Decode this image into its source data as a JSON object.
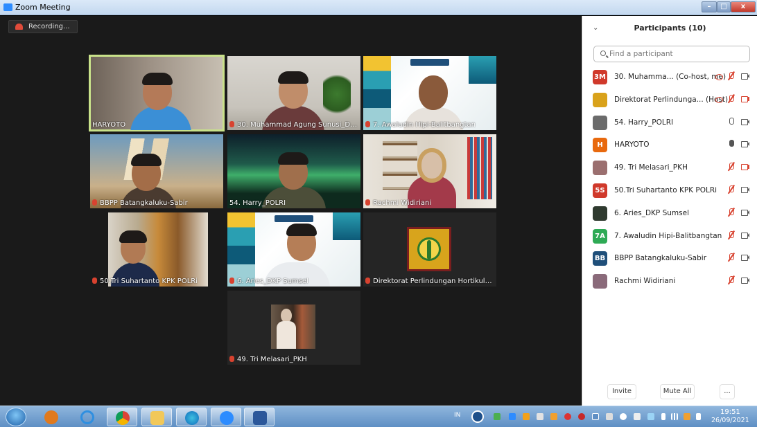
{
  "window": {
    "title": "Zoom Meeting",
    "min": "–",
    "max": "□",
    "close": "x"
  },
  "recording": {
    "label": "Recording..."
  },
  "tiles": [
    {
      "name": "HARYOTO",
      "muted": false
    },
    {
      "name": "30. Muhammad Agung Sunusi_Ditje...",
      "muted": true
    },
    {
      "name": "7. Awaludin Hipi-Balitbangtan",
      "muted": true
    },
    {
      "name": "BBPP Batangkaluku-Sabir",
      "muted": true
    },
    {
      "name": "54. Harry_POLRI",
      "muted": false
    },
    {
      "name": "Rachmi Widiriani",
      "muted": true
    },
    {
      "name": "50.Tri Suhartanto KPK POLRi",
      "muted": true
    },
    {
      "name": "6. Aries_DKP Sumsel",
      "muted": true
    },
    {
      "name": "Direktorat Perlindungan Hortikultura",
      "muted": true
    },
    {
      "name": "49. Tri Melasari_PKH",
      "muted": true
    }
  ],
  "panel": {
    "title": "Participants (10)",
    "search_placeholder": "Find a participant",
    "invite": "Invite",
    "mute_all": "Mute All",
    "more": "...",
    "participants": [
      {
        "name": "30. Muhamma...  (Co-host, me)",
        "avatar": "3M",
        "color": "#d0392b",
        "mic": "off",
        "cam": "on",
        "rec": true
      },
      {
        "name": "Direktorat Perlindunga...  (Host)",
        "avatar": "",
        "color": "#d9a21b",
        "mic": "off",
        "cam": "off",
        "rec": true
      },
      {
        "name": "54. Harry_POLRI",
        "avatar": "",
        "color": "#6b6b6b",
        "mic": "on",
        "cam": "on",
        "rec": false
      },
      {
        "name": "HARYOTO",
        "avatar": "H",
        "color": "#e8690e",
        "mic": "speaking",
        "cam": "on",
        "rec": false
      },
      {
        "name": "49. Tri Melasari_PKH",
        "avatar": "",
        "color": "#9b6f6f",
        "mic": "off",
        "cam": "off",
        "rec": false
      },
      {
        "name": "50.Tri Suhartanto KPK POLRi",
        "avatar": "5S",
        "color": "#d0392b",
        "mic": "off",
        "cam": "on",
        "rec": false
      },
      {
        "name": "6. Aries_DKP Sumsel",
        "avatar": "",
        "color": "#2f3a2f",
        "mic": "off",
        "cam": "on",
        "rec": false
      },
      {
        "name": "7. Awaludin Hipi-Balitbangtan",
        "avatar": "7A",
        "color": "#2eaa55",
        "mic": "off",
        "cam": "on",
        "rec": false
      },
      {
        "name": "BBPP Batangkaluku-Sabir",
        "avatar": "BB",
        "color": "#1f4f7a",
        "mic": "off",
        "cam": "on",
        "rec": false
      },
      {
        "name": "Rachmi Widiriani",
        "avatar": "",
        "color": "#8a6a7a",
        "mic": "off",
        "cam": "on",
        "rec": false
      }
    ]
  },
  "taskbar": {
    "lang": "IN",
    "time": "19:51",
    "date": "26/09/2021"
  }
}
